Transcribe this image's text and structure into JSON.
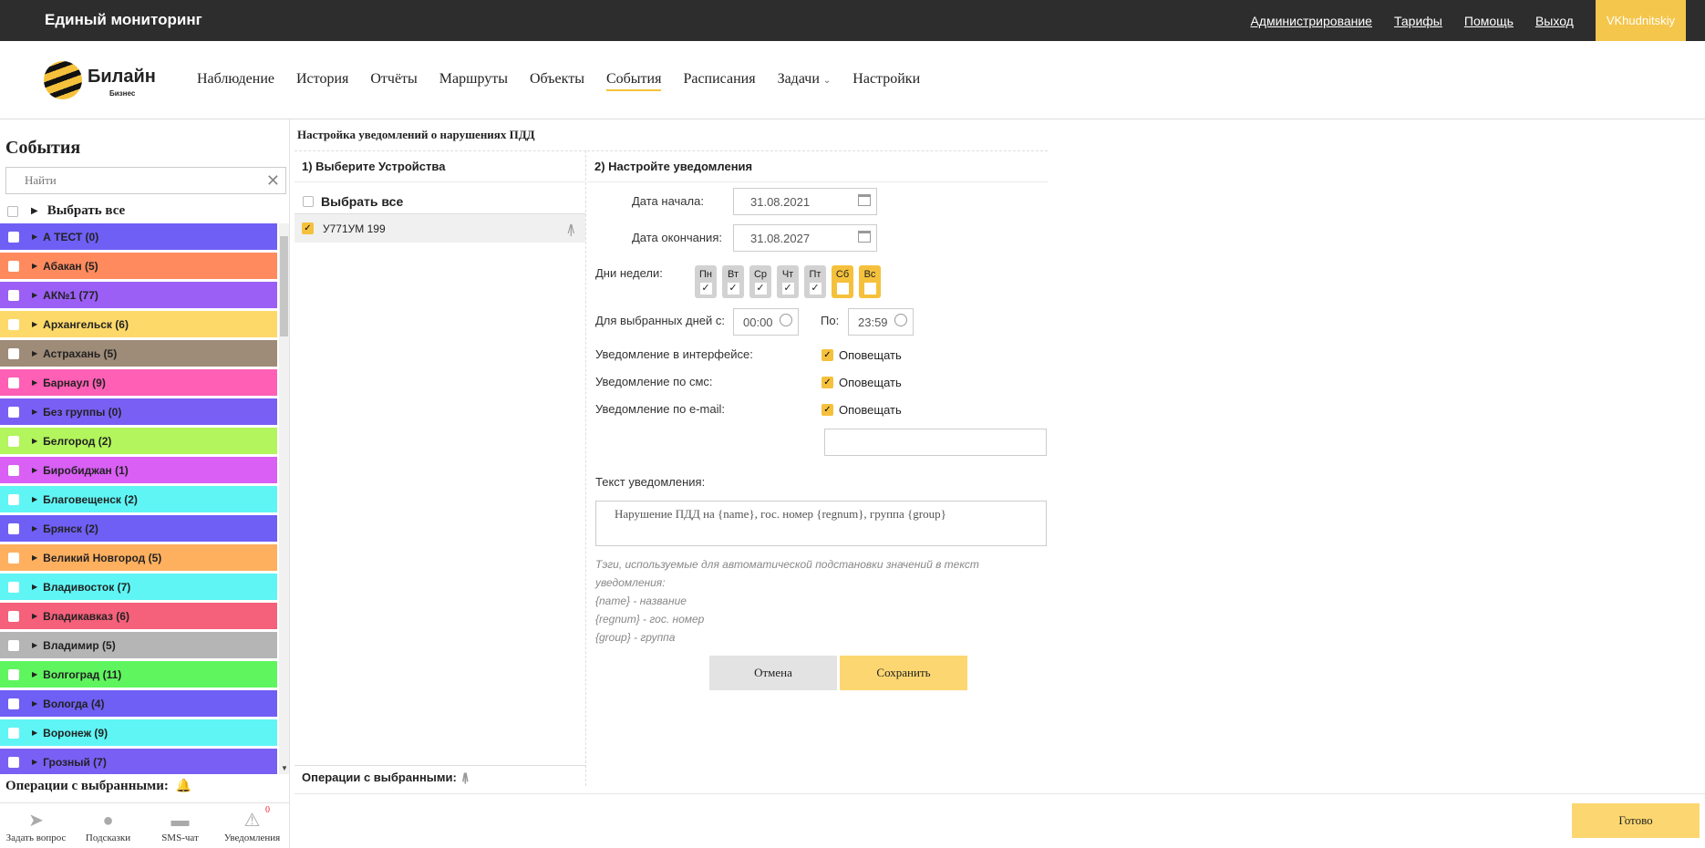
{
  "app": {
    "title": "Единый мониторинг",
    "top_links": [
      "Администрирование",
      "Тарифы",
      "Помощь",
      "Выход"
    ],
    "user": "VKhudnitskiy"
  },
  "logo": {
    "name": "Билайн",
    "sub": "Бизнес"
  },
  "nav": {
    "items": [
      "Наблюдение",
      "История",
      "Отчёты",
      "Маршруты",
      "Объекты",
      "События",
      "Расписания",
      "Задачи",
      "Настройки"
    ],
    "active": "События"
  },
  "left": {
    "title": "События",
    "search_placeholder": "Найти",
    "select_all": "Выбрать все",
    "groups": [
      {
        "label": "А ТЕСТ (0)",
        "color": "#6f5ff5"
      },
      {
        "label": "Абакан (5)",
        "color": "#ff8a5e"
      },
      {
        "label": "АК№1 (77)",
        "color": "#9b5ff5"
      },
      {
        "label": "Архангельск (6)",
        "color": "#fdd96a"
      },
      {
        "label": "Астрахань (5)",
        "color": "#9e8b78"
      },
      {
        "label": "Барнаул (9)",
        "color": "#ff5fb5"
      },
      {
        "label": "Без группы (0)",
        "color": "#7a5ff5"
      },
      {
        "label": "Белгород (2)",
        "color": "#b2f55c"
      },
      {
        "label": "Биробиджан (1)",
        "color": "#d95ff5"
      },
      {
        "label": "Благовещенск (2)",
        "color": "#5ff5f5"
      },
      {
        "label": "Брянск (2)",
        "color": "#6f5ff5"
      },
      {
        "label": "Великий Новгород (5)",
        "color": "#ffb05f"
      },
      {
        "label": "Владивосток (7)",
        "color": "#5ff5f5"
      },
      {
        "label": "Владикавказ (6)",
        "color": "#f5607a"
      },
      {
        "label": "Владимир (5)",
        "color": "#b5b5b5"
      },
      {
        "label": "Волгоград (11)",
        "color": "#5ff55f"
      },
      {
        "label": "Вологда (4)",
        "color": "#6f5ff5"
      },
      {
        "label": "Воронеж (9)",
        "color": "#5ff5f5"
      },
      {
        "label": "Грозный (7)",
        "color": "#7a5ff5"
      }
    ],
    "ops_label": "Операции с выбранными:",
    "tools": [
      {
        "label": "Задать вопрос",
        "icon": "paper-plane-icon"
      },
      {
        "label": "Подсказки",
        "icon": "bulb-icon"
      },
      {
        "label": "SMS-чат",
        "icon": "chat-icon"
      },
      {
        "label": "Уведомления",
        "icon": "warning-icon",
        "badge": "0"
      }
    ]
  },
  "content": {
    "title": "Настройка уведомлений о нарушениях ПДД",
    "devices": {
      "header": "1) Выберите Устройства",
      "select_all": "Выбрать все",
      "items": [
        "У771УМ 199"
      ],
      "ops_label": "Операции с выбранными:"
    },
    "settings": {
      "header": "2) Настройте уведомления",
      "start_label": "Дата начала:",
      "start_value": "31.08.2021",
      "end_label": "Дата окончания:",
      "end_value": "31.08.2027",
      "days_label": "Дни недели:",
      "days": [
        {
          "d": "Пн",
          "checked": true,
          "weekend": false
        },
        {
          "d": "Вт",
          "checked": true,
          "weekend": false
        },
        {
          "d": "Ср",
          "checked": true,
          "weekend": false
        },
        {
          "d": "Чт",
          "checked": true,
          "weekend": false
        },
        {
          "d": "Пт",
          "checked": true,
          "weekend": false
        },
        {
          "d": "Сб",
          "checked": false,
          "weekend": true
        },
        {
          "d": "Вс",
          "checked": false,
          "weekend": true
        }
      ],
      "time_from_label": "Для выбранных дней с:",
      "time_from": "00:00",
      "time_to_label": "По:",
      "time_to": "23:59",
      "notify_interface_label": "Уведомление в интерфейсе:",
      "notify_sms_label": "Уведомление по смс:",
      "notify_email_label": "Уведомление по e-mail:",
      "notify_option": "Оповещать",
      "text_label": "Текст уведомления:",
      "text_value": "Нарушение ПДД на {name}, гос. номер {regnum}, группа {group}",
      "hint_lines": [
        "Тэги, используемые для автоматической подстановки значений в текст уведомления:",
        "{name} - название",
        "{regnum} - гос. номер",
        "{group} - группа"
      ],
      "cancel": "Отмена",
      "save": "Сохранить"
    }
  },
  "footer": {
    "done": "Готово"
  }
}
